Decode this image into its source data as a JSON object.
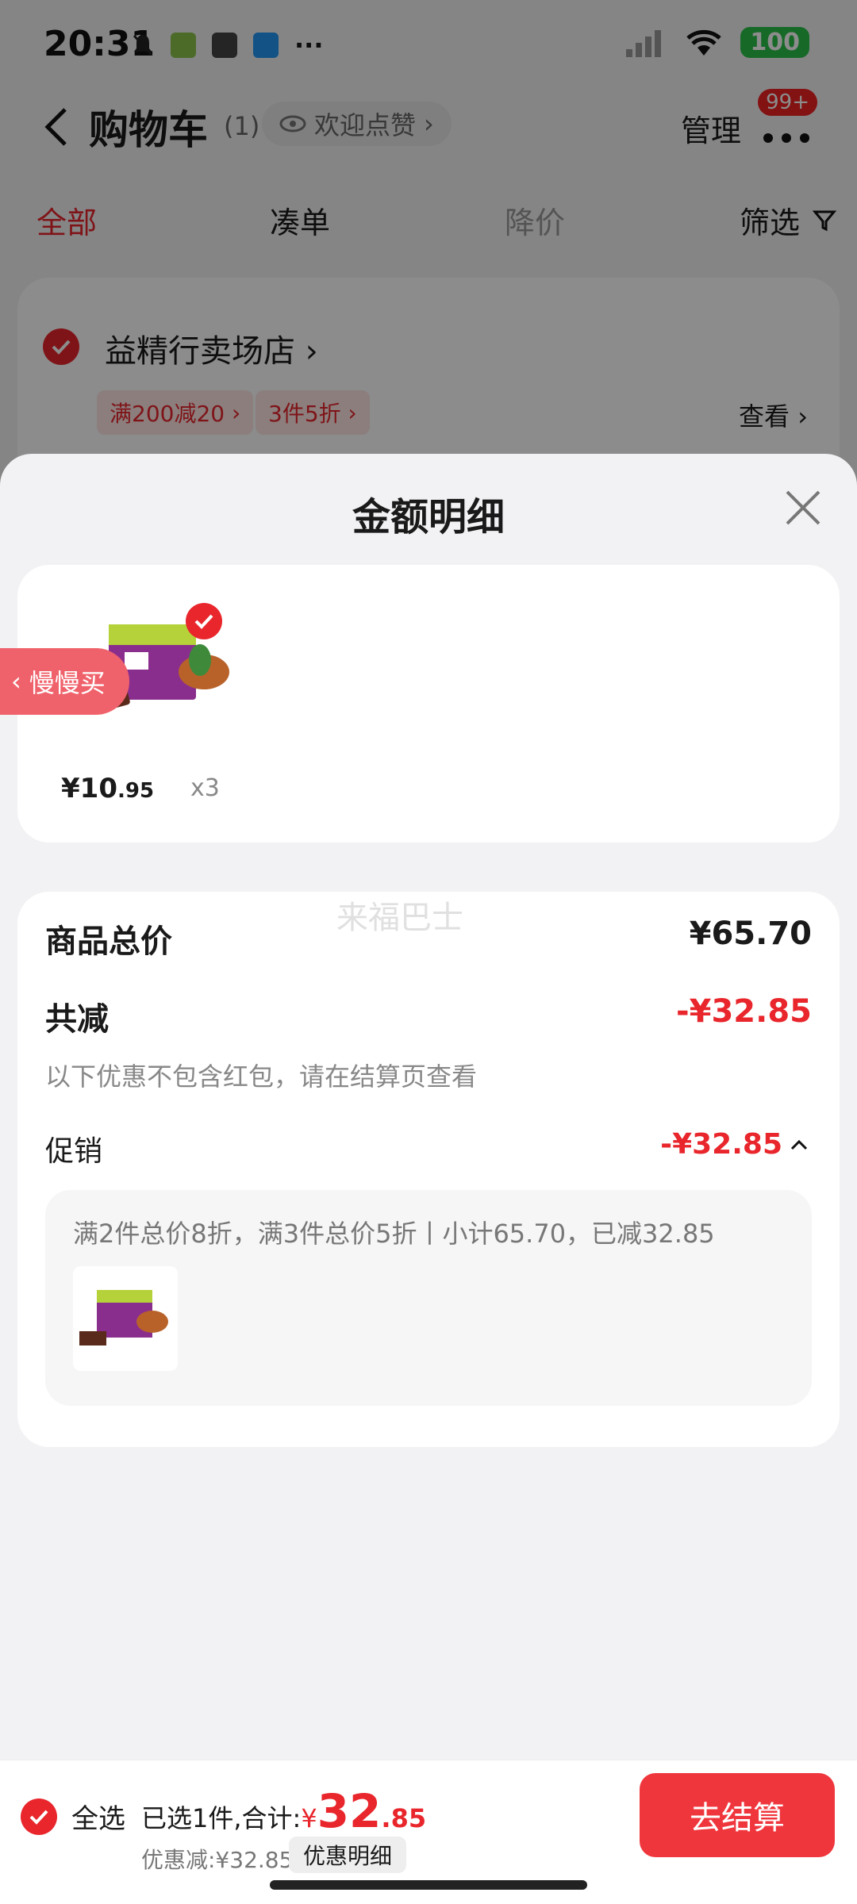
{
  "status_bar": {
    "time": "20:31",
    "battery": "100",
    "icons": [
      "mute-icon",
      "android-icon",
      "image-icon",
      "bag-icon",
      "more-dots-icon",
      "signal-icon",
      "wifi-icon"
    ]
  },
  "header": {
    "title": "购物车",
    "count": "(1)",
    "like_pill": "欢迎点赞",
    "manage": "管理",
    "badge": "99+"
  },
  "tabs": [
    {
      "label": "全部",
      "active": true
    },
    {
      "label": "凑单",
      "active": false
    },
    {
      "label": "降价",
      "active": false
    }
  ],
  "filter_label": "筛选",
  "store": {
    "name": "益精行卖场店",
    "promos": [
      "满200减20",
      "3件5折"
    ],
    "view": "查看"
  },
  "sheet": {
    "title": "金额明细",
    "item": {
      "price_int": "¥10",
      "price_dec": ".95",
      "qty": "x3",
      "slow_buy": "慢慢买"
    },
    "watermark": "来福巴士",
    "total_label": "商品总价",
    "total_value": "¥65.70",
    "discount_label": "共减",
    "discount_value": "-¥32.85",
    "discount_note": "以下优惠不包含红包，请在结算页查看",
    "promo_label": "促销",
    "promo_value": "-¥32.85",
    "promo_rule": "满2件总价8折，满3件总价5折丨小计65.70，已减32.85"
  },
  "bottom": {
    "select_all": "全选",
    "selected_text": "已选1件,合计:",
    "currency": "¥",
    "total_int": "32",
    "total_dec": ".85",
    "discount_text": "优惠减:¥32.85",
    "detail_btn": "优惠明细",
    "checkout": "去结算"
  },
  "colors": {
    "accent": "#e8262c",
    "checkout": "#f0363d",
    "battery": "#2bbf4a"
  }
}
